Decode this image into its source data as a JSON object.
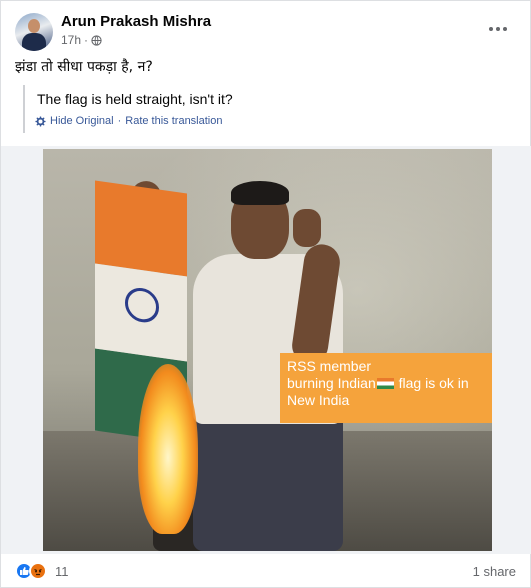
{
  "post": {
    "author": "Arun Prakash Mishra",
    "time": "17h",
    "privacy_icon": "globe-icon",
    "text": "झंडा तो सीधा पकड़ा है, न?",
    "translation": {
      "text": "The flag is held straight, isn't it?",
      "hide_label": "Hide Original",
      "separator": "·",
      "rate_label": "Rate this translation"
    },
    "more_icon": "more-options-icon"
  },
  "media": {
    "caption_line1": "RSS member",
    "caption_line2_before": "burning Indian",
    "caption_line2_after": "flag is ok in",
    "caption_line3": "New India",
    "caption_bg": "#f5a33c"
  },
  "footer": {
    "reactions": [
      "like-icon",
      "angry-icon"
    ],
    "reaction_count": "11",
    "shares": "1 share"
  },
  "colors": {
    "link": "#385898",
    "meta": "#65676b",
    "like": "#1877f2",
    "angry": "#e9710f"
  }
}
